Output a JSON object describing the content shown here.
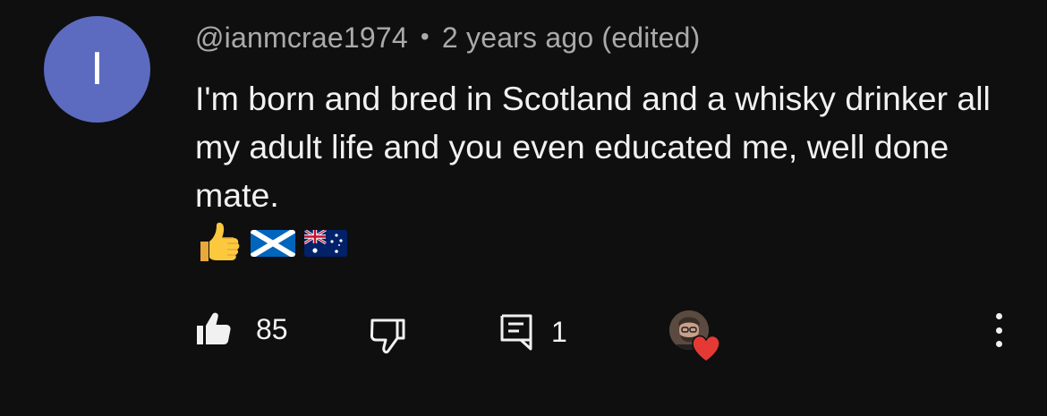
{
  "comment": {
    "avatar_letter": "I",
    "avatar_color": "#5c6bc0",
    "author": "@ianmcrae1974",
    "separator": "•",
    "timestamp": "2 years ago (edited)",
    "text": "I'm born and bred in Scotland and a whisky drinker all my adult life and you even educated me, well done mate.",
    "emojis": [
      "thumbs-up-emoji",
      "scotland-flag-emoji",
      "australia-flag-emoji"
    ]
  },
  "actions": {
    "like_count": "85",
    "reply_count": "1",
    "creator_heart": true,
    "heart_color": "#e53935"
  },
  "colors": {
    "background": "#0f0f0f",
    "primary_text": "#f1f1f1",
    "secondary_text": "#aaaaaa"
  }
}
